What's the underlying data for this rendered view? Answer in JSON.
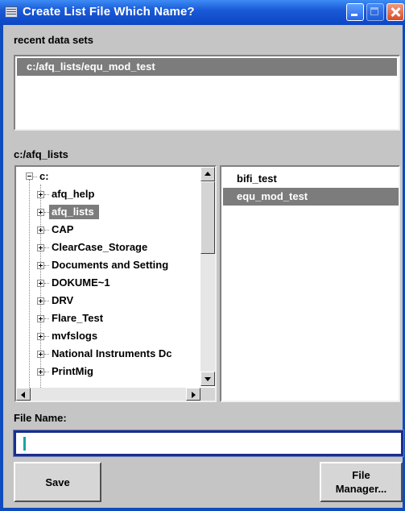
{
  "window": {
    "title": "Create List File Which Name?"
  },
  "recent": {
    "label": "recent data sets",
    "items": [
      "c:/afq_lists/equ_mod_test"
    ]
  },
  "path": {
    "label": "c:/afq_lists"
  },
  "tree": {
    "root": "c:",
    "items": [
      "afq_help",
      "afq_lists",
      "CAP",
      "ClearCase_Storage",
      "Documents and Setting",
      "DOKUME~1",
      "DRV",
      "Flare_Test",
      "mvfslogs",
      "National Instruments Dc",
      "PrintMig"
    ],
    "selected": "afq_lists"
  },
  "files": {
    "items": [
      "bifi_test",
      "equ_mod_test"
    ],
    "selected": "equ_mod_test"
  },
  "filename": {
    "label": "File Name:",
    "value": ""
  },
  "buttons": {
    "save": "Save",
    "file_manager_line1": "File",
    "file_manager_line2": "Manager..."
  },
  "colors": {
    "title_bar": "#0c46c4",
    "selection": "#7c7c7c",
    "dialog_bg": "#c5c5c5"
  }
}
